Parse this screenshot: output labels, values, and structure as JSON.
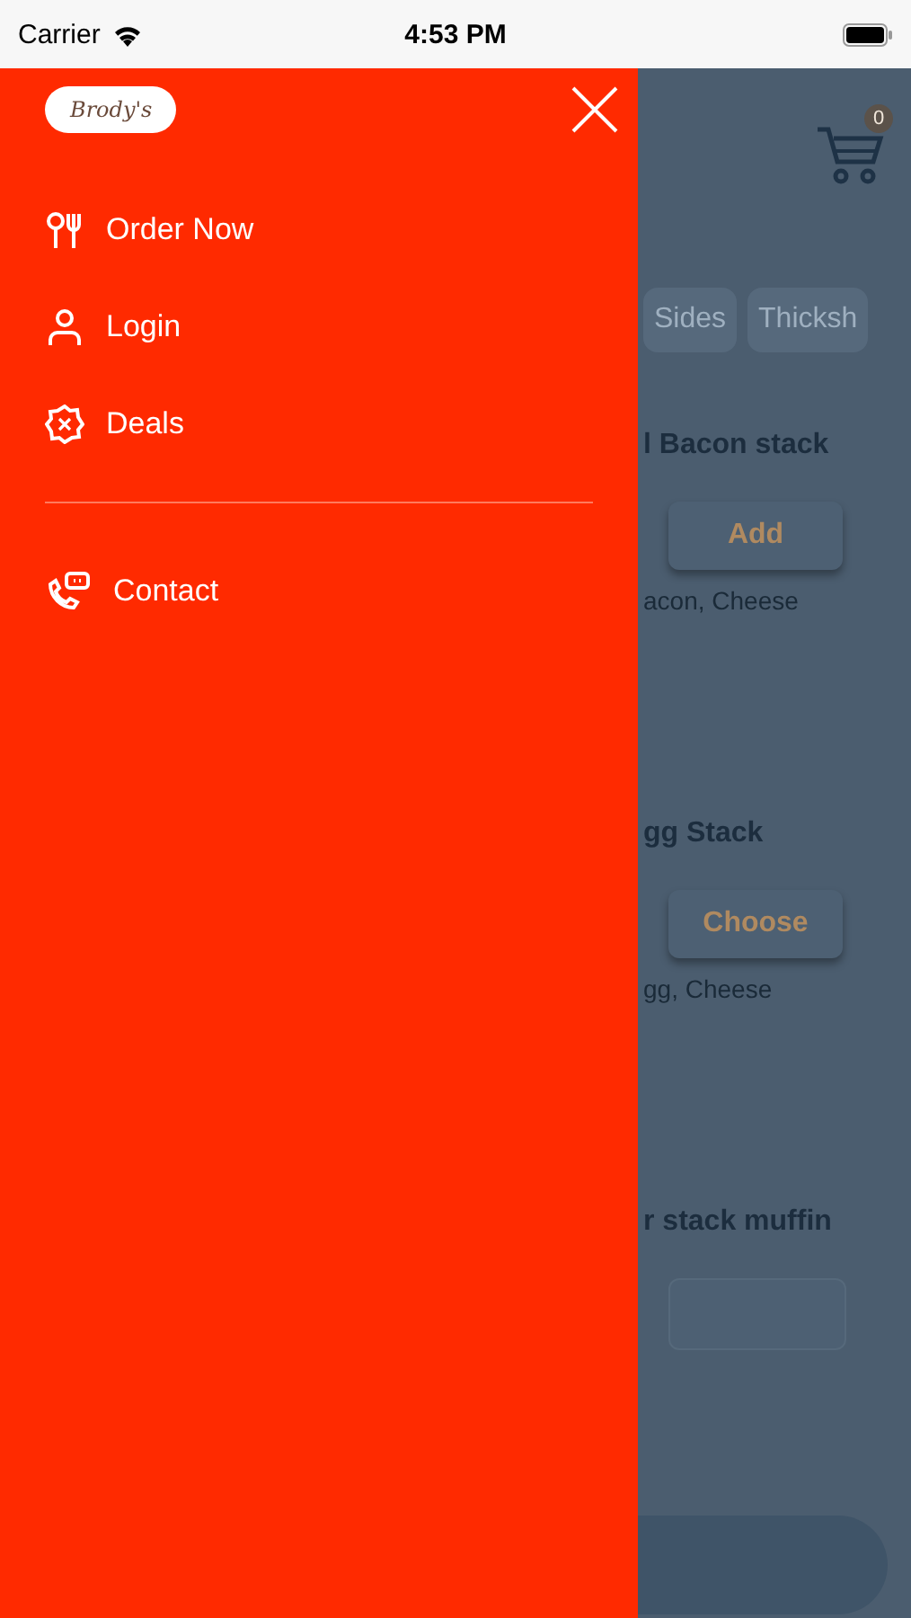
{
  "status_bar": {
    "carrier": "Carrier",
    "time": "4:53 PM"
  },
  "background": {
    "cart_count": "0",
    "categories": [
      "Sides",
      "Thicksh"
    ],
    "products": [
      {
        "title": "l Bacon stack",
        "button": "Add",
        "description": "acon, Cheese"
      },
      {
        "title": "gg Stack",
        "button": "Choose",
        "description": "gg, Cheese"
      },
      {
        "title": "r stack muffin"
      }
    ]
  },
  "drawer": {
    "logo": "Brody's",
    "items": [
      {
        "label": "Order Now",
        "kind": "order"
      },
      {
        "label": "Login",
        "kind": "login"
      },
      {
        "label": "Deals",
        "kind": "deals"
      }
    ],
    "secondary_items": [
      {
        "label": "Contact",
        "kind": "contact"
      }
    ]
  }
}
